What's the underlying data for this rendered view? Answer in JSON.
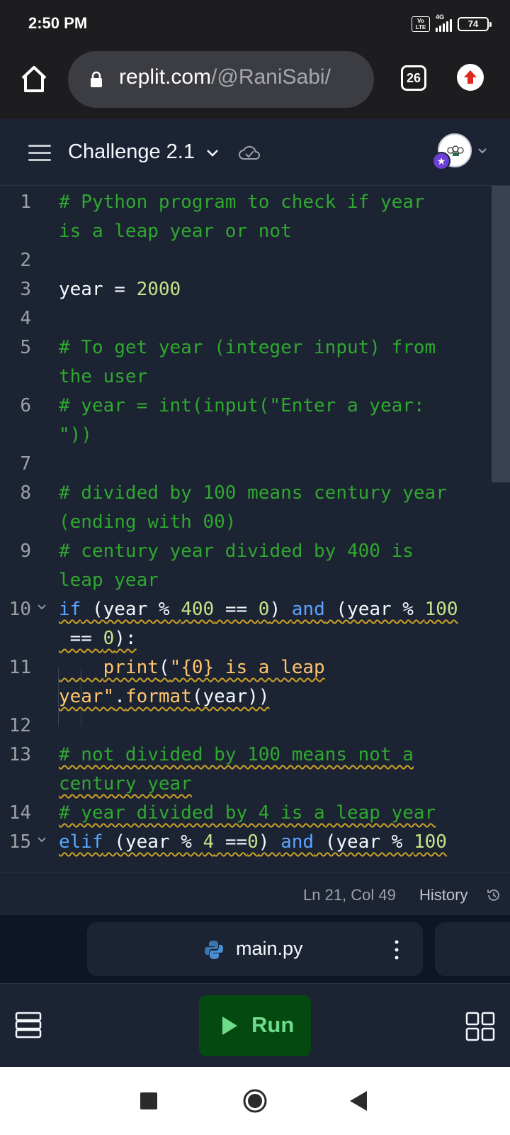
{
  "status_bar": {
    "time": "2:50 PM",
    "volte": "Vo LTE",
    "network": "4G",
    "battery": "74"
  },
  "browser": {
    "url_host": "replit.com",
    "url_path": "/@RaniSabi/",
    "tab_count": "26"
  },
  "header": {
    "repl_name": "Challenge 2.1"
  },
  "editor": {
    "lines": [
      {
        "num": "1",
        "text": "# Python program to check if year"
      },
      {
        "num": "",
        "text": "is a leap year or not"
      },
      {
        "num": "2",
        "text": ""
      },
      {
        "num": "3",
        "text": "year = 2000"
      },
      {
        "num": "4",
        "text": ""
      },
      {
        "num": "5",
        "text": "# To get year (integer input) from"
      },
      {
        "num": "",
        "text": "the user"
      },
      {
        "num": "6",
        "text": "# year = int(input(\"Enter a year:"
      },
      {
        "num": "",
        "text": "\"))"
      },
      {
        "num": "7",
        "text": ""
      },
      {
        "num": "8",
        "text": "# divided by 100 means century year"
      },
      {
        "num": "",
        "text": "(ending with 00)"
      },
      {
        "num": "9",
        "text": "# century year divided by 400 is"
      },
      {
        "num": "",
        "text": "leap year"
      },
      {
        "num": "10",
        "text": "if (year % 400 == 0) and (year % 100"
      },
      {
        "num": "",
        "text": " == 0):"
      },
      {
        "num": "11",
        "text": "    print(\"{0} is a leap"
      },
      {
        "num": "",
        "text": "year\".format(year))"
      },
      {
        "num": "12",
        "text": ""
      },
      {
        "num": "13",
        "text": "# not divided by 100 means not a"
      },
      {
        "num": "",
        "text": "century year"
      },
      {
        "num": "14",
        "text": "# year divided by 4 is a leap year"
      },
      {
        "num": "15",
        "text": "elif (year % 4 ==0) and (year % 100"
      }
    ],
    "cursor_position": "Ln 21, Col 49",
    "history_label": "History"
  },
  "file_tab": {
    "name": "main.py"
  },
  "toolbar": {
    "run_label": "Run"
  },
  "colors": {
    "background": "#1c2333",
    "comment": "#2fa82f",
    "keyword": "#5aa6ff",
    "number": "#c8e18b",
    "string": "#ffc56b",
    "run_button": "#044a10",
    "run_text": "#6fdc8c"
  }
}
